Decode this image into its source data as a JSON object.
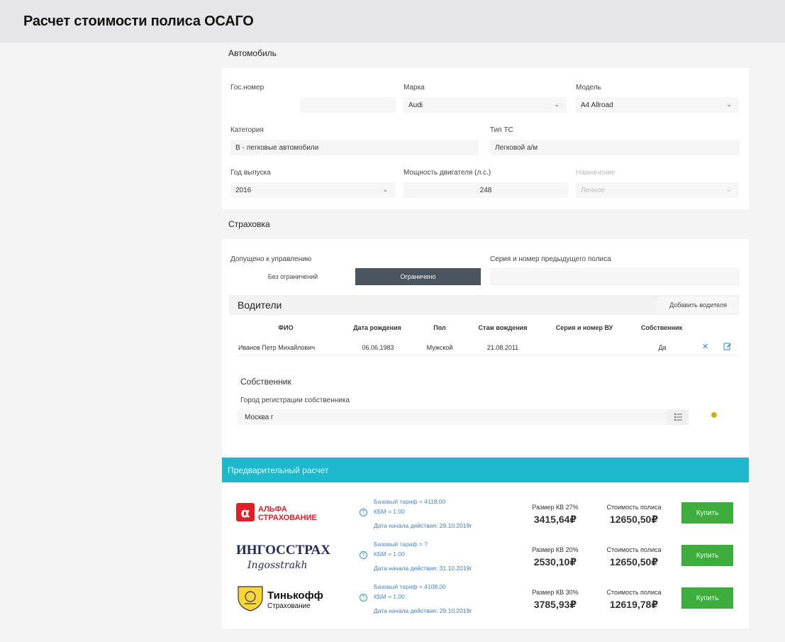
{
  "header": {
    "title": "Расчет стоимости полиса ОСАГО"
  },
  "car": {
    "section_title": "Автомобиль",
    "plate": {
      "label": "Гос.номер",
      "value": ""
    },
    "brand": {
      "label": "Марка",
      "value": "Audi"
    },
    "model": {
      "label": "Модель",
      "value": "A4 Allroad"
    },
    "category": {
      "label": "Категория",
      "value": "B - легковые автомобили"
    },
    "vehicle_type": {
      "label": "Тип ТС",
      "value": "Легковой а/м"
    },
    "year": {
      "label": "Год выпуска",
      "value": "2016"
    },
    "power": {
      "label": "Мощность двигателя (л.с.)",
      "value": "248"
    },
    "purpose": {
      "label": "Назначение",
      "value": "Личное"
    }
  },
  "insurance": {
    "section_title": "Страховка",
    "allowed_label": "Допущено к управлению",
    "toggle": {
      "unlimited": "Без ограничений",
      "limited": "Ограничено"
    },
    "prev_policy_label": "Серия и номер предыдущего полиса",
    "drivers": {
      "title": "Водители",
      "add_button": "Добавить водителя",
      "columns": [
        "ФИО",
        "Дата рождения",
        "Пол",
        "Стаж вождения",
        "Серия и номер ВУ",
        "Собственник"
      ],
      "rows": [
        {
          "name": "Иванов Петр Михайлович",
          "birth": "06.06.1983",
          "gender": "Мужской",
          "experience": "21.08.2011",
          "license": "",
          "owner": "Да"
        }
      ]
    },
    "owner": {
      "title": "Собственник",
      "city_label": "Город регистрации собственника",
      "city_value": "Москва г"
    }
  },
  "prelim": {
    "title": "Предварительный расчет",
    "offers": [
      {
        "logo": "alfa-strahovanie-logo",
        "logo_line1": "АЛЬФА",
        "logo_line2": "СТРАХОВАНИЕ",
        "base": "Базовый тариф = 4118,00",
        "kbm": "КБМ = 1.00",
        "start": "Дата начала действия: 29.10.2019г",
        "kv_label": "Размер КВ 27%",
        "kv_value": "3415,64₽",
        "cost_label": "Стоимость полиса",
        "cost_value": "12650,50₽",
        "buy": "Купить"
      },
      {
        "logo": "ingosstrakh-logo",
        "logo_line1": "ИНГОССТРАХ",
        "logo_line2": "Ingosstrakh",
        "base": "Базовый тариф = ?",
        "kbm": "КБМ = 1.00",
        "start": "Дата начала действия: 31.10.2019г",
        "kv_label": "Размер КВ 20%",
        "kv_value": "2530,10₽",
        "cost_label": "Стоимость полиса",
        "cost_value": "12650,50₽",
        "buy": "Купить"
      },
      {
        "logo": "tinkoff-logo",
        "logo_line1": "Тинькофф",
        "logo_line2": "Страхование",
        "base": "Базовый тариф = 4108,00",
        "kbm": "КБМ = 1.00",
        "start": "Дата начала действия: 29.10.2019г",
        "kv_label": "Размер КВ 30%",
        "kv_value": "3785,93₽",
        "cost_label": "Стоимость полиса",
        "cost_value": "12619,78₽",
        "buy": "Купить"
      }
    ]
  },
  "colors": {
    "accent": "#1cb8cc",
    "buy": "#3dae3d",
    "toggle_active": "#4a5560",
    "alfa_red": "#e01f26",
    "ingos_navy": "#1f2a5a"
  }
}
